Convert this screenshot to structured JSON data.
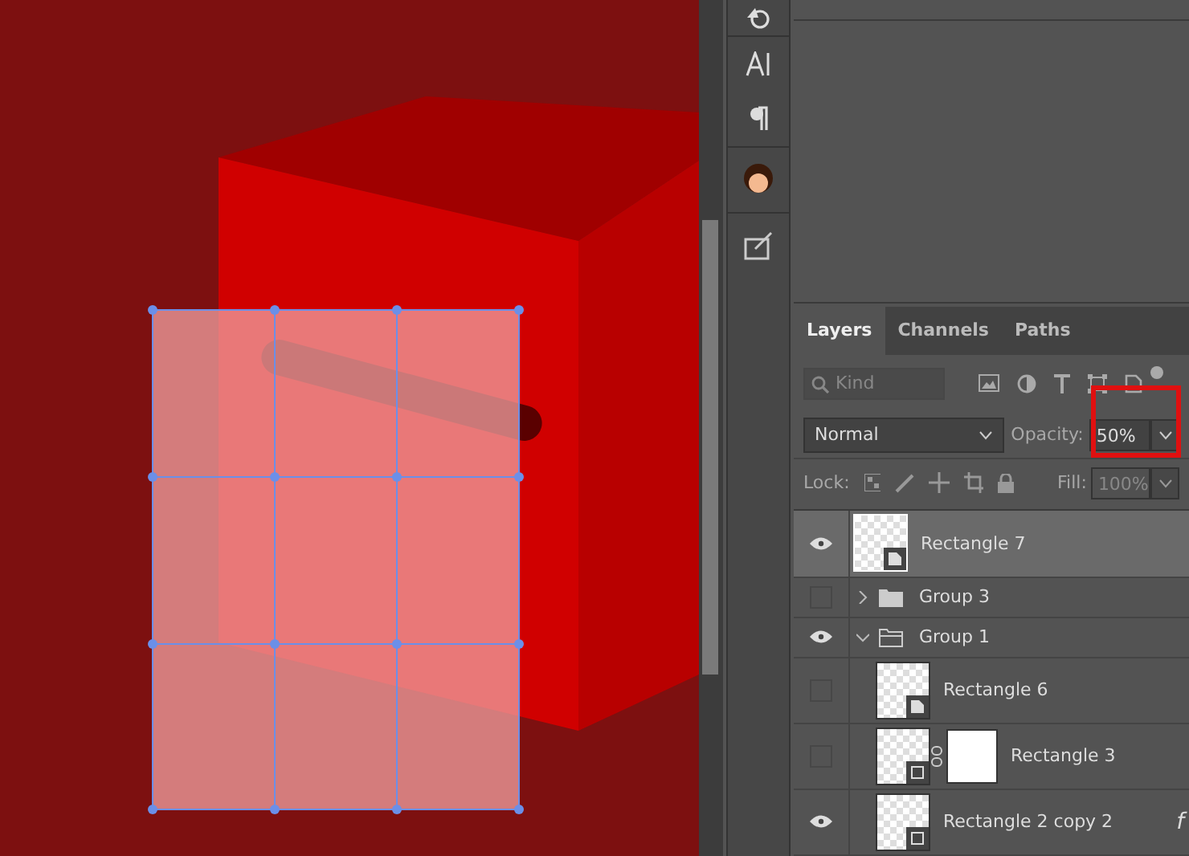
{
  "tools": [
    {
      "kind": "history"
    },
    {
      "kind": "character"
    },
    {
      "kind": "paragraph"
    },
    {
      "kind": "avatar"
    },
    {
      "kind": "tablet"
    }
  ],
  "tabs": [
    {
      "label": "Layers",
      "selected": true
    },
    {
      "label": "Channels",
      "selected": false
    },
    {
      "label": "Paths",
      "selected": false
    }
  ],
  "filter": {
    "placeholder": "Kind"
  },
  "blend_mode": "Normal",
  "opacity": {
    "label": "Opacity:",
    "value": "50%",
    "highlighted": true
  },
  "lock": {
    "label": "Lock:"
  },
  "fill": {
    "label": "Fill:",
    "value": "100%"
  },
  "layers": [
    {
      "name": "Rectangle 7",
      "kind": "smart",
      "visible": true,
      "selected": true
    },
    {
      "name": "Group 3",
      "kind": "group",
      "visible": false,
      "selected": false,
      "expanded": false
    },
    {
      "name": "Group 1",
      "kind": "group",
      "visible": true,
      "selected": false,
      "expanded": true,
      "children": [
        {
          "name": "Rectangle 6",
          "kind": "smart",
          "visible": false,
          "selected": false
        },
        {
          "name": "Rectangle 3",
          "kind": "shape",
          "visible": false,
          "selected": false,
          "mask": true
        },
        {
          "name": "Rectangle 2 copy 2",
          "kind": "shape",
          "visible": true,
          "selected": false,
          "effects": "f"
        }
      ]
    }
  ]
}
